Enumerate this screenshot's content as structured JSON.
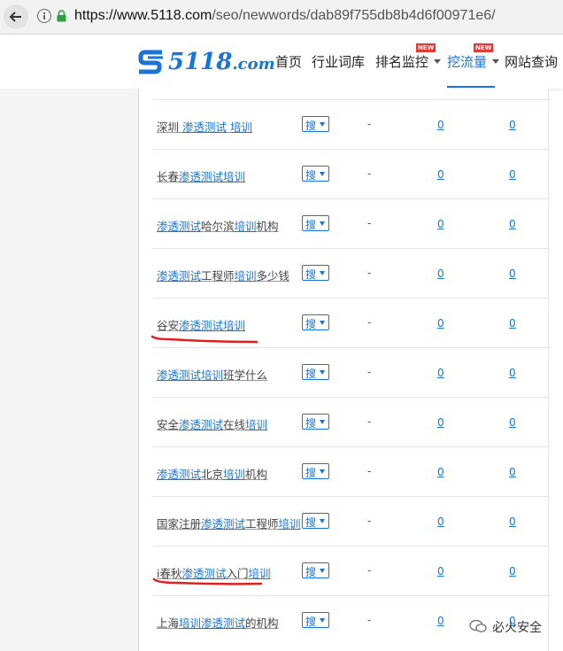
{
  "browser": {
    "url_host": "https://www.5118.com",
    "url_path": "/seo/newwords/dab89f755db8b4d6f00971e6/"
  },
  "header": {
    "logo_text": "5118",
    "logo_suffix": ".com",
    "nav": [
      {
        "label": "首页"
      },
      {
        "label": "行业词库"
      },
      {
        "label": "排名监控",
        "badge": "NEW"
      },
      {
        "label": "挖流量",
        "badge": "NEW"
      },
      {
        "label": "网站查询"
      }
    ]
  },
  "table": {
    "search_label": "搜",
    "rows": [
      {
        "segments": [
          {
            "t": "深圳 ",
            "s": "plain"
          },
          {
            "t": "渗透测试",
            "s": "hl"
          },
          {
            "t": " ",
            "s": "plain"
          },
          {
            "t": "培训",
            "s": "hl"
          }
        ],
        "dash": "-",
        "c1": "0",
        "c2": "0"
      },
      {
        "segments": [
          {
            "t": "长春",
            "s": "plain"
          },
          {
            "t": "渗透测试培训",
            "s": "hl"
          }
        ],
        "dash": "-",
        "c1": "0",
        "c2": "0"
      },
      {
        "segments": [
          {
            "t": "渗透测试",
            "s": "hl"
          },
          {
            "t": "哈尔滨",
            "s": "plain"
          },
          {
            "t": "培训",
            "s": "hl"
          },
          {
            "t": "机构",
            "s": "plain"
          }
        ],
        "dash": "-",
        "c1": "0",
        "c2": "0"
      },
      {
        "segments": [
          {
            "t": "渗透测试",
            "s": "hl"
          },
          {
            "t": "工程师",
            "s": "plain"
          },
          {
            "t": "培训",
            "s": "hl"
          },
          {
            "t": "多少钱",
            "s": "plain"
          }
        ],
        "dash": "-",
        "c1": "0",
        "c2": "0"
      },
      {
        "segments": [
          {
            "t": "谷安",
            "s": "plain"
          },
          {
            "t": "渗透测试培训",
            "s": "hl"
          }
        ],
        "dash": "-",
        "c1": "0",
        "c2": "0"
      },
      {
        "segments": [
          {
            "t": "渗透测试培训",
            "s": "hl"
          },
          {
            "t": "班学什么",
            "s": "plain"
          }
        ],
        "dash": "-",
        "c1": "0",
        "c2": "0"
      },
      {
        "segments": [
          {
            "t": "安全",
            "s": "plain"
          },
          {
            "t": "渗透测试",
            "s": "hl"
          },
          {
            "t": "在线",
            "s": "plain"
          },
          {
            "t": "培训",
            "s": "hl"
          }
        ],
        "dash": "-",
        "c1": "0",
        "c2": "0"
      },
      {
        "segments": [
          {
            "t": "渗透测试",
            "s": "hl"
          },
          {
            "t": "北京",
            "s": "plain"
          },
          {
            "t": "培训",
            "s": "hl"
          },
          {
            "t": "机构",
            "s": "plain"
          }
        ],
        "dash": "-",
        "c1": "0",
        "c2": "0"
      },
      {
        "segments": [
          {
            "t": "国家注册",
            "s": "plain"
          },
          {
            "t": "渗透测试",
            "s": "hl"
          },
          {
            "t": "工程师",
            "s": "plain"
          },
          {
            "t": "培训",
            "s": "hl"
          }
        ],
        "dash": "-",
        "c1": "0",
        "c2": "0"
      },
      {
        "segments": [
          {
            "t": "i春秋",
            "s": "plain"
          },
          {
            "t": "渗透测试",
            "s": "hl"
          },
          {
            "t": "入门",
            "s": "plain"
          },
          {
            "t": "培训",
            "s": "hl"
          }
        ],
        "dash": "-",
        "c1": "0",
        "c2": "0"
      },
      {
        "segments": [
          {
            "t": "上海",
            "s": "plain"
          },
          {
            "t": "培训渗透测试",
            "s": "hl"
          },
          {
            "t": "的机构",
            "s": "plain"
          }
        ],
        "dash": "-",
        "c1": "0",
        "c2": "0"
      }
    ]
  },
  "watermark": {
    "text": "必火安全"
  },
  "colors": {
    "accent": "#1a73d9",
    "badge": "#e53935",
    "annotation": "#e02020"
  }
}
